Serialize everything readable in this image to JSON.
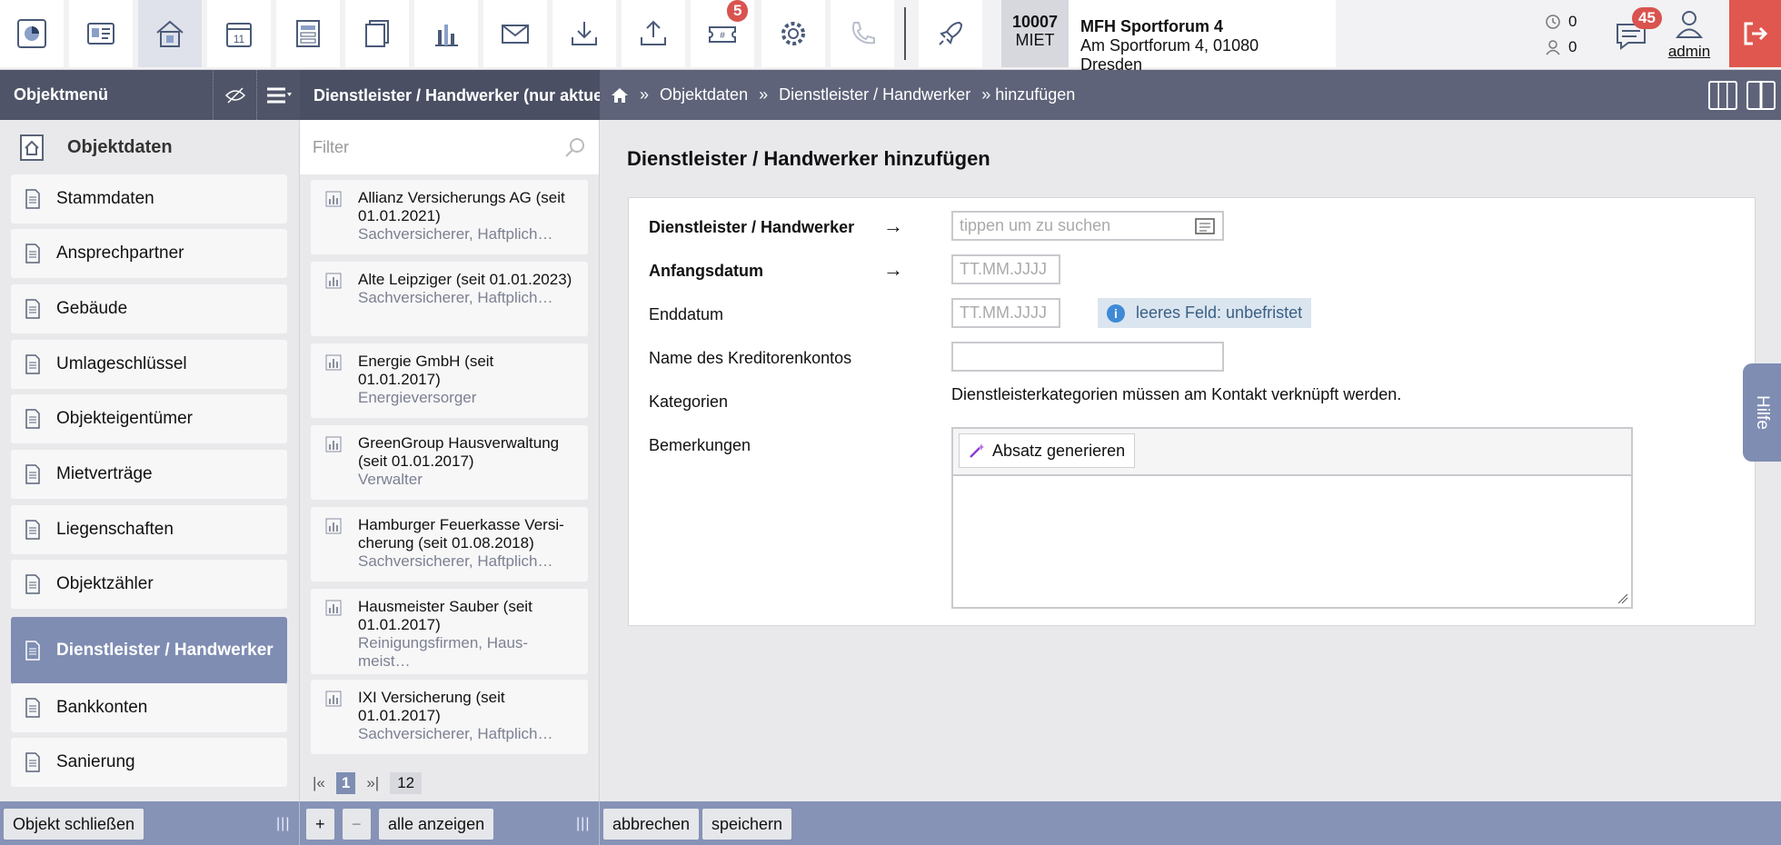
{
  "toolbar": {
    "buttons": [
      {
        "icon": "dashboard-icon"
      },
      {
        "icon": "contacts-icon"
      },
      {
        "icon": "home-icon"
      },
      {
        "icon": "calendar-icon",
        "text": "11"
      },
      {
        "icon": "forms-icon"
      },
      {
        "icon": "documents-icon"
      },
      {
        "icon": "statistics-icon"
      },
      {
        "icon": "mail-icon"
      },
      {
        "icon": "download-icon"
      },
      {
        "icon": "upload-icon"
      },
      {
        "icon": "tickets-icon",
        "badge": "5"
      },
      {
        "icon": "settings-icon"
      },
      {
        "icon": "phone-icon"
      },
      {
        "icon": "rocket-icon"
      }
    ],
    "object_id": "10007",
    "object_type": "MIET",
    "object_name": "MFH Sportforum 4",
    "object_address": "Am Sportforum 4, 01080 Dresden",
    "counter1": "0",
    "counter2": "0",
    "messages_badge": "45",
    "user": "admin"
  },
  "navbar": {
    "menu_title": "Objektmenü",
    "list_title": "Dienstleister / Handwerker (nur aktuelle)",
    "breadcrumb": [
      "»",
      "Objektdaten",
      "»",
      "Dienstleister / Handwerker",
      "» hinzufügen"
    ]
  },
  "sidebar": {
    "header": "Objektdaten",
    "items": [
      {
        "label": "Stammdaten"
      },
      {
        "label": "Ansprechpartner"
      },
      {
        "label": "Gebäude"
      },
      {
        "label": "Umlageschlüssel"
      },
      {
        "label": "Objekteigentümer"
      },
      {
        "label": "Mietverträge"
      },
      {
        "label": "Liegenschaften"
      },
      {
        "label": "Objektzähler"
      },
      {
        "label": "Dienstleister / Handwerker",
        "active": true
      },
      {
        "label": "Bankkonten"
      },
      {
        "label": "Sanierung"
      }
    ]
  },
  "list": {
    "filter_placeholder": "Filter",
    "items": [
      {
        "title": "Allianz Versicherungs AG (seit 01.01.2021)",
        "sub": "Sachversicherer, Haftplich…"
      },
      {
        "title": "Alte Leipziger (seit 01.01.2023)",
        "sub": "Sachversicherer, Haftplich…"
      },
      {
        "title": "Energie GmbH (seit 01.01.2017)",
        "sub": "Energieversorger"
      },
      {
        "title": "GreenGroup Hausverwaltung (seit 01.01.2017)",
        "sub": "Verwalter"
      },
      {
        "title": "Hamburger Feuerkasse Versi-cherung (seit 01.08.2018)",
        "sub": "Sachversicherer, Haftplich…"
      },
      {
        "title": "Hausmeister Sauber (seit 01.01.2017)",
        "sub": "Reinigungsfirmen, Haus-meist…"
      },
      {
        "title": "IXI Versicherung (seit 01.01.2017)",
        "sub": "Sachversicherer, Haftplich…"
      }
    ],
    "pager_first": "|«",
    "pager_current": "1",
    "pager_last": "»|",
    "total": "12"
  },
  "form": {
    "title": "Dienstleister / Handwerker hinzufügen",
    "provider_label": "Dienstleister / Handwerker",
    "provider_placeholder": "tippen um zu suchen",
    "start_label": "Anfangsdatum",
    "start_placeholder": "TT.MM.JJJJ",
    "end_label": "Enddatum",
    "end_placeholder": "TT.MM.JJJJ",
    "end_hint": "leeres Feld: unbefristet",
    "creditor_label": "Name des Kreditorenkontos",
    "creditor_value": "",
    "categories_label": "Kategorien",
    "categories_text": "Dienstleisterkategorien müssen am Kontakt verknüpft werden.",
    "remarks_label": "Bemerkungen",
    "generate_button": "Absatz generieren",
    "remarks_value": ""
  },
  "help_tab": "Hilfe",
  "bottom": {
    "close_object": "Objekt schließen",
    "add": "+",
    "remove": "−",
    "show_all": "alle anzeigen",
    "cancel": "abbrechen",
    "save": "speichern"
  },
  "colors": {
    "accent": "#7f8db3",
    "navbar": "#5e6379",
    "badge": "#d9534f",
    "logout": "#e0574f"
  }
}
